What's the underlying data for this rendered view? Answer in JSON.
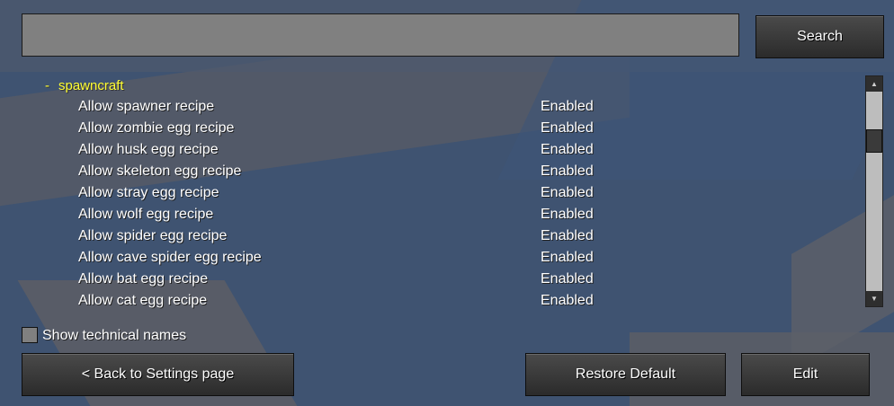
{
  "search": {
    "value": "",
    "button_label": "Search"
  },
  "category": {
    "toggle": "-",
    "name": "spawncraft"
  },
  "options": [
    {
      "label": "Allow spawner recipe",
      "value": "Enabled"
    },
    {
      "label": "Allow zombie egg recipe",
      "value": "Enabled"
    },
    {
      "label": "Allow husk egg recipe",
      "value": "Enabled"
    },
    {
      "label": "Allow skeleton egg recipe",
      "value": "Enabled"
    },
    {
      "label": "Allow stray egg recipe",
      "value": "Enabled"
    },
    {
      "label": "Allow wolf egg recipe",
      "value": "Enabled"
    },
    {
      "label": "Allow spider egg recipe",
      "value": "Enabled"
    },
    {
      "label": "Allow cave spider egg recipe",
      "value": "Enabled"
    },
    {
      "label": "Allow bat egg recipe",
      "value": "Enabled"
    },
    {
      "label": "Allow cat egg recipe",
      "value": "Enabled"
    }
  ],
  "scrollbar": {
    "up_icon": "▲",
    "down_icon": "▼"
  },
  "footer": {
    "checkbox_label": "Show technical names",
    "back_label": "< Back to Settings page",
    "restore_label": "Restore Default",
    "edit_label": "Edit"
  },
  "colors": {
    "category": "#ffff33",
    "background": "#3f5371",
    "button": "#2f2f2f"
  }
}
